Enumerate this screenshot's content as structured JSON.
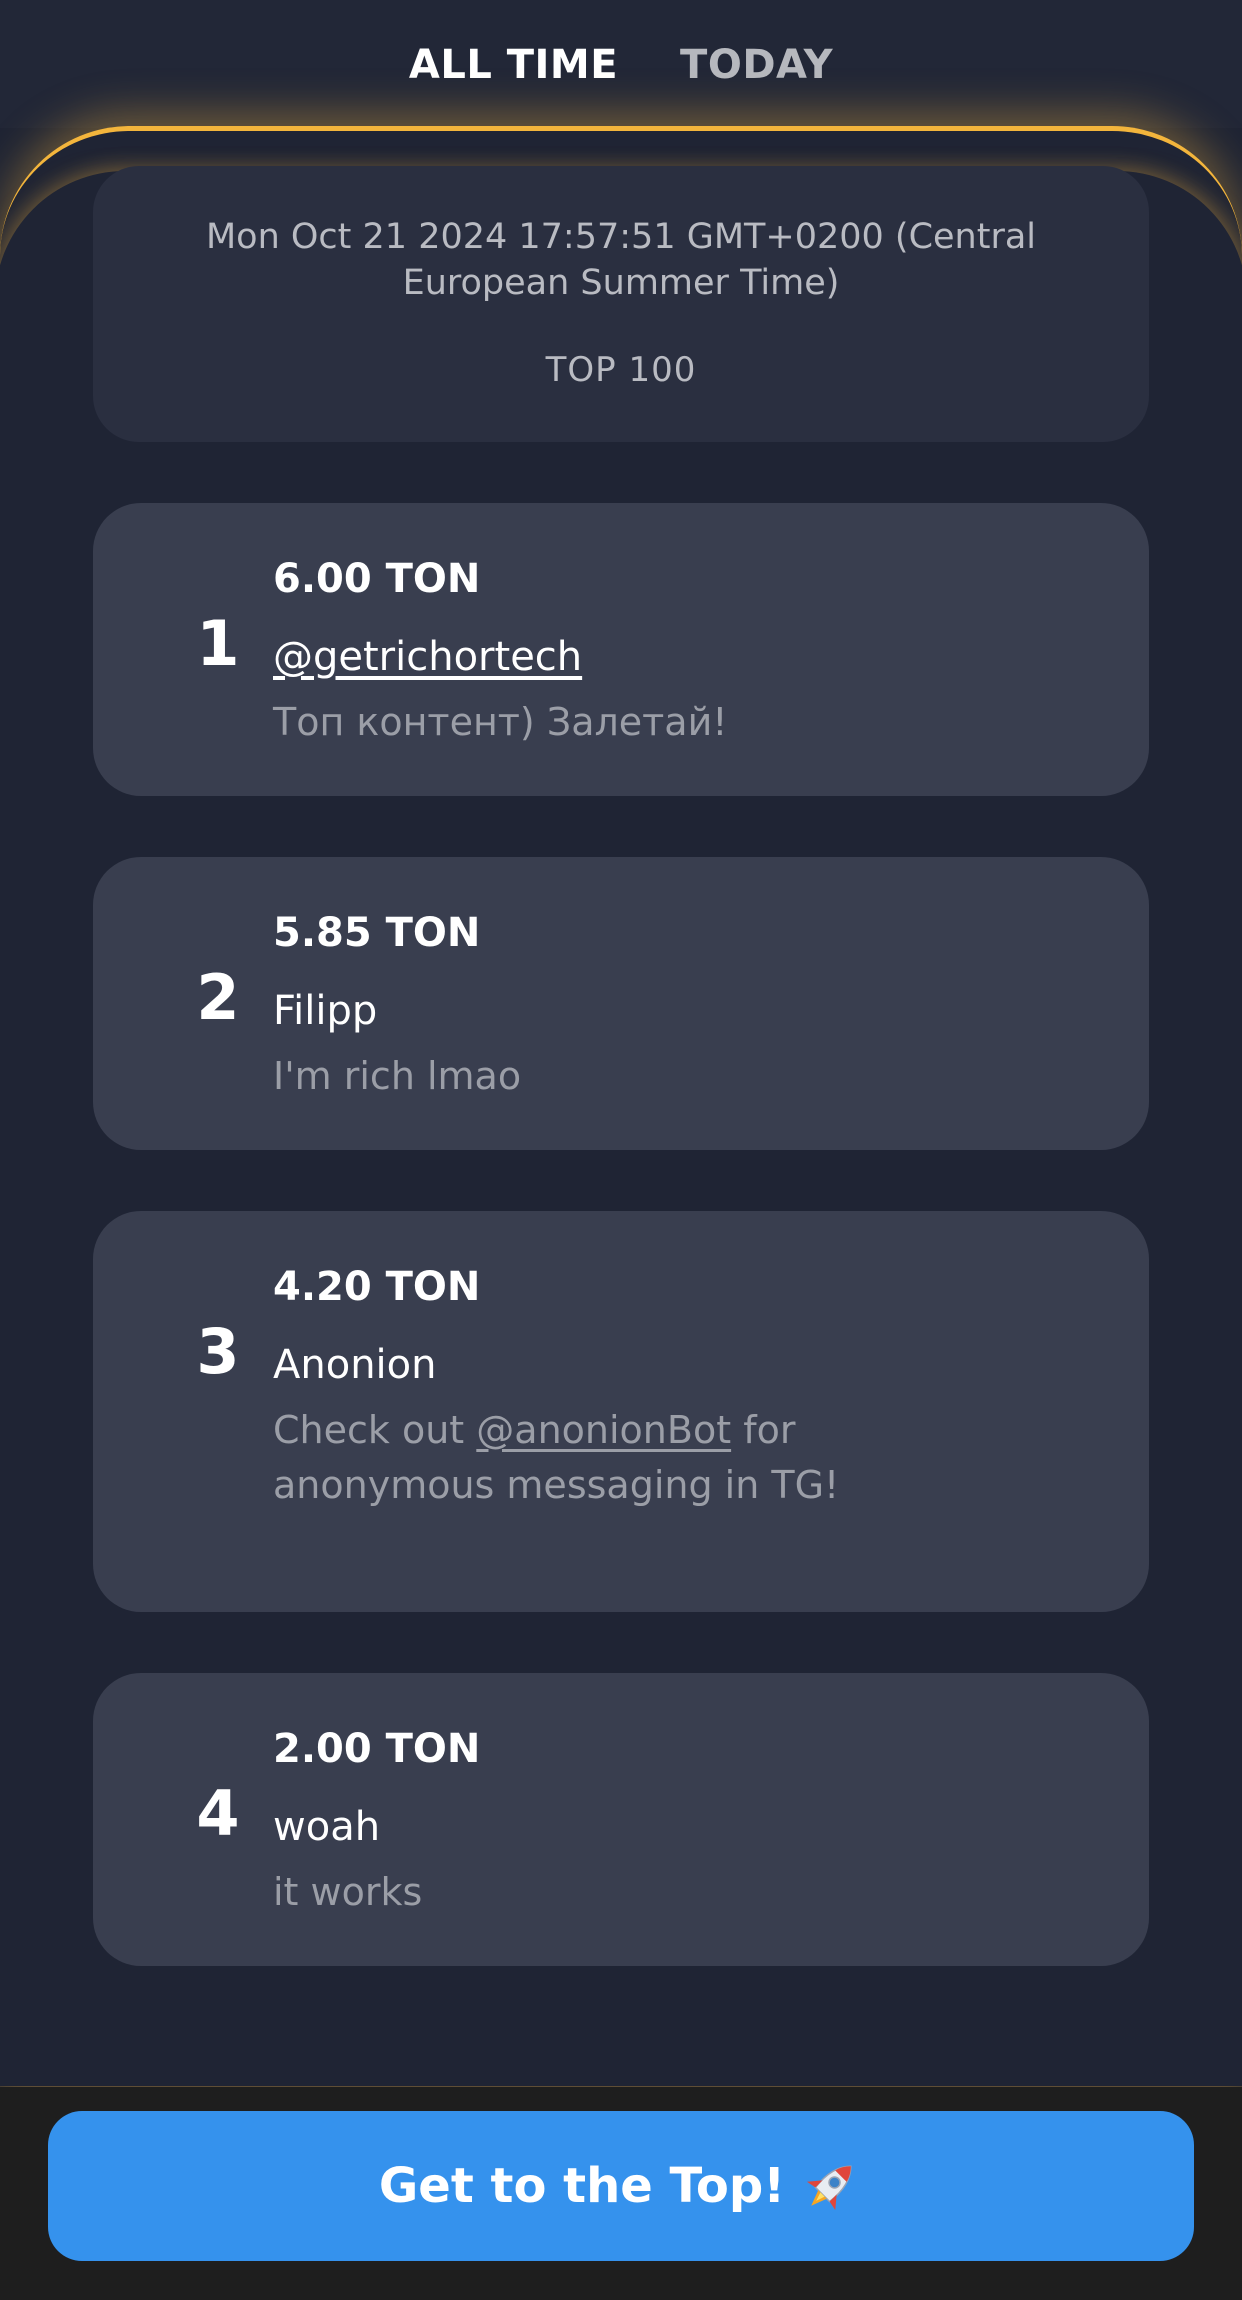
{
  "tabs": {
    "all_time": "ALL TIME",
    "today": "TODAY",
    "active": "all_time"
  },
  "info": {
    "date": "Mon Oct 21 2024 17:57:51 GMT+0200 (Central European Summer Time)",
    "top_label": "TOP 100"
  },
  "entries": [
    {
      "rank": "1",
      "amount": "6.00 TON",
      "name": "@getrichortech",
      "name_is_link": true,
      "message": "Топ контент) Залетай!"
    },
    {
      "rank": "2",
      "amount": "5.85 TON",
      "name": "Filipp",
      "name_is_link": false,
      "message": "I'm rich lmao"
    },
    {
      "rank": "3",
      "amount": "4.20 TON",
      "name": "Anonion",
      "name_is_link": false,
      "message_prefix": "Check out ",
      "message_link": "@anonionBot",
      "message_suffix": " for anonymous messaging in TG!"
    },
    {
      "rank": "4",
      "amount": "2.00 TON",
      "name": "woah",
      "name_is_link": false,
      "message": "it works"
    }
  ],
  "cta": {
    "label": "Get to the Top!",
    "icon": "rocket-icon"
  },
  "colors": {
    "accent_glow": "#f3b53c",
    "cta_blue": "#3592ed",
    "card_bg": "#393e4f",
    "page_bg": "#1f2434"
  }
}
